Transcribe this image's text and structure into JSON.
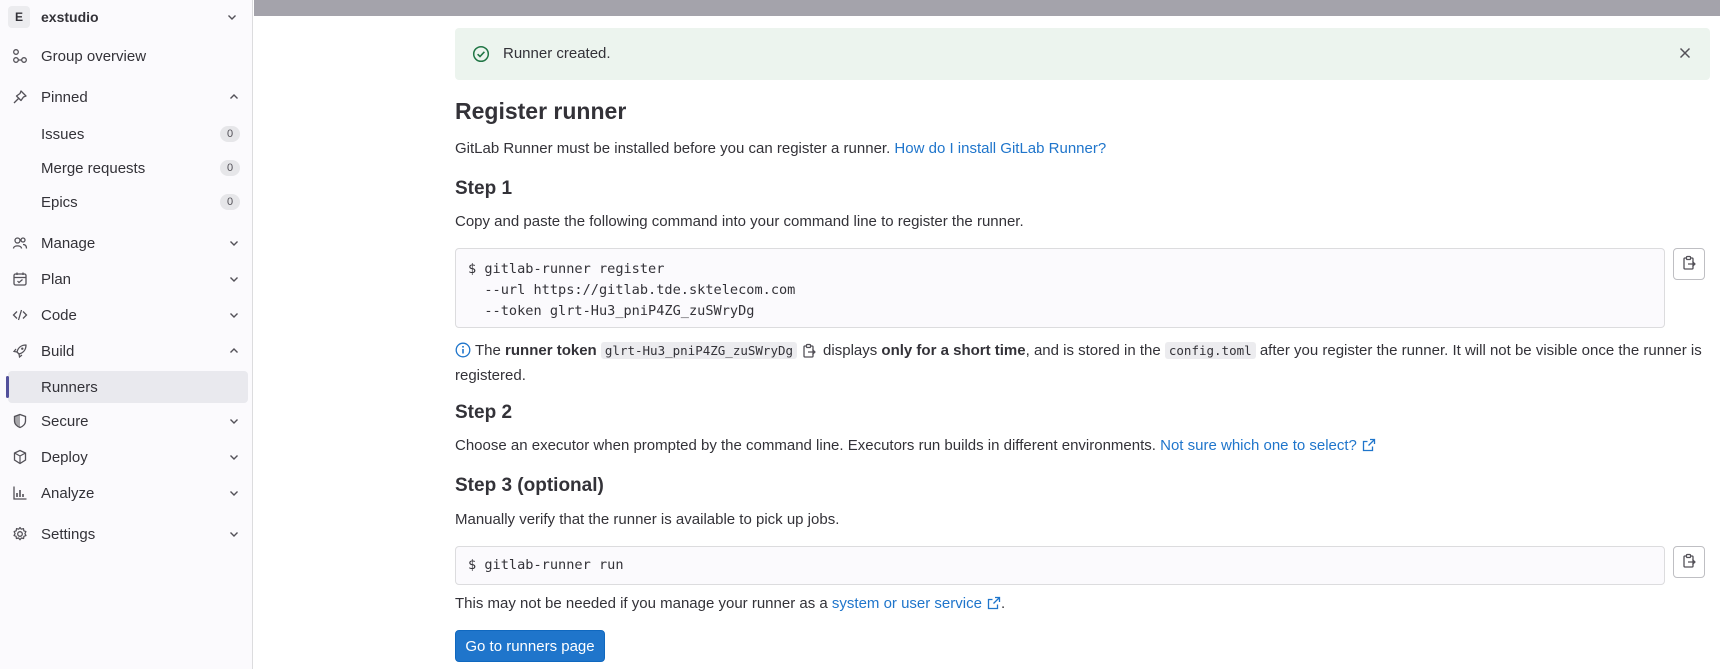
{
  "sidebar": {
    "group": {
      "avatar_letter": "E",
      "name": "exstudio"
    },
    "items": [
      {
        "label": "Group overview",
        "icon": "group-overview-icon"
      },
      {
        "label": "Pinned",
        "icon": "pin-icon"
      },
      {
        "label": "Issues",
        "count": "0"
      },
      {
        "label": "Merge requests",
        "count": "0"
      },
      {
        "label": "Epics",
        "count": "0"
      },
      {
        "label": "Manage",
        "icon": "users-icon"
      },
      {
        "label": "Plan",
        "icon": "calendar-icon"
      },
      {
        "label": "Code",
        "icon": "code-icon"
      },
      {
        "label": "Build",
        "icon": "rocket-icon"
      },
      {
        "label": "Runners"
      },
      {
        "label": "Secure",
        "icon": "shield-icon"
      },
      {
        "label": "Deploy",
        "icon": "deploy-icon"
      },
      {
        "label": "Analyze",
        "icon": "chart-icon"
      },
      {
        "label": "Settings",
        "icon": "gear-icon"
      }
    ]
  },
  "alert": {
    "text": "Runner created."
  },
  "page": {
    "title": "Register runner",
    "intro": "GitLab Runner must be installed before you can register a runner.",
    "intro_link": "How do I install GitLab Runner?",
    "step1": {
      "heading": "Step 1",
      "text": "Copy and paste the following command into your command line to register the runner.",
      "command": "$ gitlab-runner register\n  --url https://gitlab.tde.sktelecom.com\n  --token glrt-Hu3_pniP4ZG_zuSWryDg",
      "info_prefix": "The",
      "info_bold1": "runner token",
      "token": "glrt-Hu3_pniP4ZG_zuSWryDg",
      "info_mid1": "displays",
      "info_bold2": "only for a short time",
      "info_mid2": ", and is stored in the",
      "config_file": "config.toml",
      "info_suffix": "after you register the runner. It will not be visible once the runner is registered."
    },
    "step2": {
      "heading": "Step 2",
      "text": "Choose an executor when prompted by the command line. Executors run builds in different environments.",
      "link": "Not sure which one to select?"
    },
    "step3": {
      "heading": "Step 3 (optional)",
      "text": "Manually verify that the runner is available to pick up jobs.",
      "command": "$ gitlab-runner run",
      "note_prefix": "This may not be needed if you manage your runner as a",
      "note_link": "system or user service",
      "note_suffix": "."
    },
    "button": "Go to runners page"
  },
  "colors": {
    "link": "#1f75cb",
    "primary": "#1f75cb",
    "success_bg": "#ecf4ee",
    "success_icon": "#217645"
  }
}
